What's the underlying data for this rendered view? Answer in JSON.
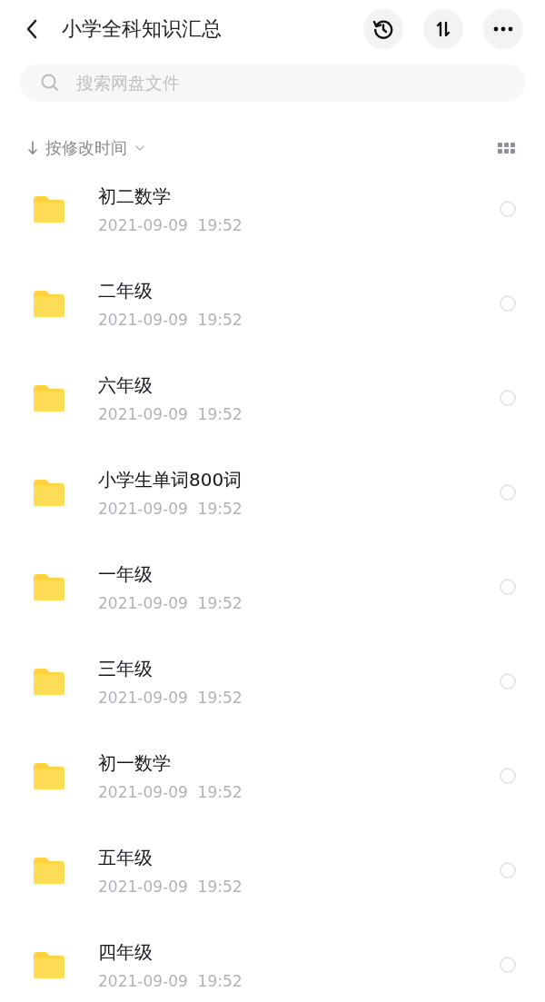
{
  "header": {
    "title": "小学全科知识汇总"
  },
  "search": {
    "placeholder": "搜索网盘文件"
  },
  "sort": {
    "label": "按修改时间"
  },
  "files": [
    {
      "name": "初二数学",
      "modified": "2021-09-09  19:52",
      "selected": false
    },
    {
      "name": "二年级",
      "modified": "2021-09-09  19:52",
      "selected": false
    },
    {
      "name": "六年级",
      "modified": "2021-09-09  19:52",
      "selected": false
    },
    {
      "name": "小学生单词800词",
      "modified": "2021-09-09  19:52",
      "selected": false
    },
    {
      "name": "一年级",
      "modified": "2021-09-09  19:52",
      "selected": false
    },
    {
      "name": "三年级",
      "modified": "2021-09-09  19:52",
      "selected": false
    },
    {
      "name": "初一数学",
      "modified": "2021-09-09  19:52",
      "selected": false
    },
    {
      "name": "五年级",
      "modified": "2021-09-09  19:52",
      "selected": false
    },
    {
      "name": "四年级",
      "modified": "2021-09-09  19:52",
      "selected": false
    }
  ]
}
